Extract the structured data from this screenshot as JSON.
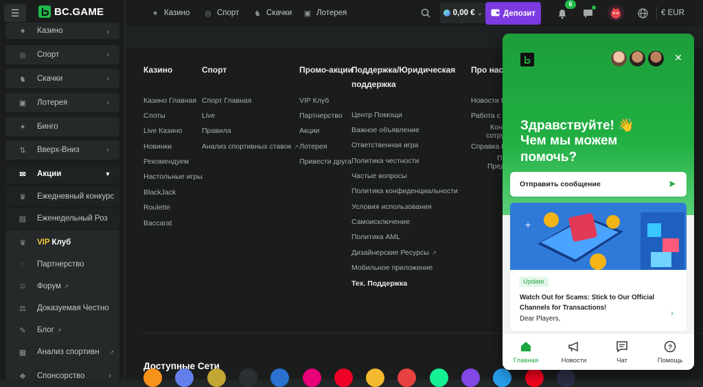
{
  "brand": {
    "name": "BC.GAME"
  },
  "sidebar": {
    "items": [
      {
        "label": "Казино",
        "icon": "casino-icon"
      },
      {
        "label": "Спорт",
        "icon": "sport-icon"
      },
      {
        "label": "Скачки",
        "icon": "horse-icon"
      },
      {
        "label": "Лотерея",
        "icon": "lottery-icon"
      },
      {
        "label": "Бинго",
        "icon": "bingo-icon"
      },
      {
        "label": "Вверх-Вниз",
        "icon": "updown-icon"
      },
      {
        "label": "Акции",
        "icon": "promo-icon"
      }
    ],
    "promo_sub": [
      {
        "label": "Ежедневный конкурс",
        "icon": "contest-icon"
      },
      {
        "label": "Еженедельный Роз",
        "icon": "raffle-icon"
      }
    ],
    "vip_prefix": "VIP",
    "vip_label": "Клуб",
    "group": [
      {
        "label": "Партнерство",
        "icon": "partner-icon"
      },
      {
        "label": "Форум",
        "icon": "forum-icon",
        "external": true
      },
      {
        "label": "Доказуемая Честно",
        "icon": "fairness-icon"
      },
      {
        "label": "Блог",
        "icon": "blog-icon",
        "external": true
      },
      {
        "label": "Анализ спортивн",
        "icon": "analysis-icon",
        "external": true
      },
      {
        "label": "Спонсорство",
        "icon": "sponsor-icon"
      }
    ]
  },
  "topbar": {
    "nav": [
      {
        "label": "Казино",
        "icon": "casino-icon"
      },
      {
        "label": "Спорт",
        "icon": "sport-icon"
      },
      {
        "label": "Скачки",
        "icon": "horse-icon"
      },
      {
        "label": "Лотерея",
        "icon": "lottery-icon"
      }
    ],
    "balance": "0,00 €",
    "deposit": "Депозит",
    "notifications": "6",
    "currency": "€ EUR"
  },
  "footer": {
    "columns": [
      {
        "title": "Казино",
        "links": [
          "Казино Главная",
          "Слоты",
          "Live Казино",
          "Новинки",
          "Рекомендуем",
          "Настольные игры",
          "BlackJack",
          "Roulette",
          "Baccarat"
        ]
      },
      {
        "title": "Спорт",
        "links": [
          "Спорт Главная",
          "Live",
          "Правила",
          "Анализ спортивных ставок"
        ]
      },
      {
        "title": "Промо-акции",
        "links": [
          "VIP Клуб",
          "Партнерство",
          "Акции",
          "Лотерея",
          "Привести друга"
        ]
      },
      {
        "title_1": "Поддержка/Юридическая",
        "title_2": "поддержка",
        "links": [
          "Центр Помощи",
          "Важное объявление",
          "Ответственная игра",
          "Политика честности",
          "Частые вопросы",
          "Политика конфиденциальности",
          "Условия использования",
          "Самоисключение",
          "Политика AML",
          "Дизайнерские Ресурсы",
          "Мобильное приложение",
          "Тех. Поддержка"
        ]
      },
      {
        "title": "Про нас",
        "links": [
          "Новости Б",
          "Работа с н",
          "Конт",
          "сотру",
          "Справка В",
          "П",
          "Пред"
        ]
      }
    ],
    "networks_title": "Доступные Сети",
    "networks": [
      {
        "name": "bitcoin-icon",
        "color": "#f7931a"
      },
      {
        "name": "ethereum-icon",
        "color": "#627eea"
      },
      {
        "name": "dogecoin-icon",
        "color": "#c2a633"
      },
      {
        "name": "xrp-icon",
        "color": "#2b2f33"
      },
      {
        "name": "cardano-icon",
        "color": "#2a71d0"
      },
      {
        "name": "polkadot-icon",
        "color": "#e6007a"
      },
      {
        "name": "tron-icon",
        "color": "#ef0027"
      },
      {
        "name": "bnb-icon",
        "color": "#f3ba2f"
      },
      {
        "name": "avalanche-icon",
        "color": "#e84142"
      },
      {
        "name": "solana-icon",
        "color": "#14f195"
      },
      {
        "name": "polygon-icon",
        "color": "#8247e5"
      },
      {
        "name": "arbitrum-icon",
        "color": "#28a0f0"
      },
      {
        "name": "optimism-icon",
        "color": "#ff0420"
      },
      {
        "name": "cosmos-icon",
        "color": "#2e3148"
      }
    ]
  },
  "chat_widget": {
    "greeting_1": "Здравствуйте! 👋",
    "greeting_2": "Чем мы можем",
    "greeting_3": "помочь?",
    "send_message": "Отправить сообщение",
    "news_tag": "Update",
    "news_title": "Watch Out for Scams: Stick to Our Official Channels for Transactions!",
    "news_body": "Dear Players,",
    "tabs": [
      "Главная",
      "Новости",
      "Чат",
      "Помощь"
    ],
    "accent": "#21b043"
  }
}
